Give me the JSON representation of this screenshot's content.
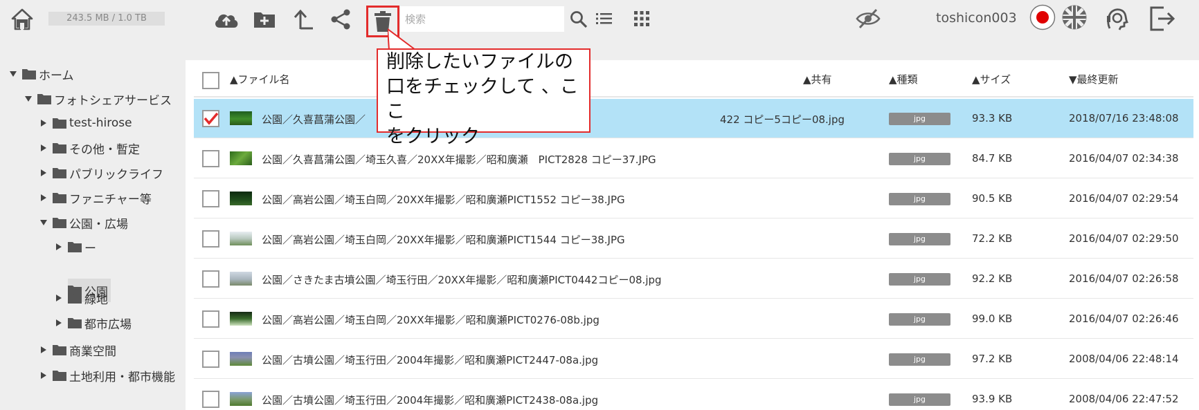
{
  "topbar": {
    "storage": "243.5 MB / 1.0 TB",
    "search_placeholder": "検索",
    "username": "toshicon003",
    "icons": [
      "home-icon",
      "cloud-upload-icon",
      "new-folder-icon",
      "upload-icon",
      "share-icon",
      "trash-icon",
      "search-icon",
      "list-view-icon",
      "grid-view-icon",
      "hide-icon",
      "japanese-flag-icon",
      "uk-flag-icon",
      "support-icon",
      "logout-icon"
    ]
  },
  "sidebar": {
    "items": [
      {
        "label": "ホーム",
        "expanded": true
      },
      {
        "label": "フォトシェアサービス",
        "expanded": true
      },
      {
        "label": "test-hirose",
        "expanded": false
      },
      {
        "label": "その他・暫定",
        "expanded": false
      },
      {
        "label": "パブリックライフ",
        "expanded": false
      },
      {
        "label": "ファニチャー等",
        "expanded": false
      },
      {
        "label": "公園・広場",
        "expanded": true
      },
      {
        "label": "ー",
        "expanded": false
      },
      {
        "label": "公園",
        "selected": true
      },
      {
        "label": "緑地",
        "expanded": false
      },
      {
        "label": "都市広場",
        "expanded": false
      },
      {
        "label": "商業空間",
        "expanded": false
      },
      {
        "label": "土地利用・都市機能",
        "expanded": false
      }
    ]
  },
  "table": {
    "headers": {
      "name": "▲ファイル名",
      "shared": "▲共有",
      "type": "▲種類",
      "size": "▲サイズ",
      "modified": "▼最終更新"
    },
    "rows": [
      {
        "name_start": "公園／久喜菖蒲公園／",
        "name_end": "422 コピー5コピー08.jpg",
        "type": "jpg",
        "size": "93.3 KB",
        "modified": "2018/07/16 23:48:08",
        "checked": true
      },
      {
        "name": "公園／久喜菖蒲公園／埼玉久喜／20XX年撮影／昭和廣瀬　PICT2828 コピー37.JPG",
        "type": "jpg",
        "size": "84.7 KB",
        "modified": "2016/04/07 02:34:38"
      },
      {
        "name": "公園／高岩公園／埼玉白岡／20XX年撮影／昭和廣瀬PICT1552 コピー38.JPG",
        "type": "jpg",
        "size": "90.5 KB",
        "modified": "2016/04/07 02:29:54"
      },
      {
        "name": "公園／高岩公園／埼玉白岡／20XX年撮影／昭和廣瀬PICT1544 コピー38.JPG",
        "type": "jpg",
        "size": "72.2 KB",
        "modified": "2016/04/07 02:29:50"
      },
      {
        "name": "公園／さきたま古墳公園／埼玉行田／20XX年撮影／昭和廣瀬PICT0442コピー08.jpg",
        "type": "jpg",
        "size": "92.2 KB",
        "modified": "2016/04/07 02:26:58"
      },
      {
        "name": "公園／高岩公園／埼玉白岡／20XX年撮影／昭和廣瀬PICT0276-08b.jpg",
        "type": "jpg",
        "size": "99.0 KB",
        "modified": "2016/04/07 02:26:46"
      },
      {
        "name": "公園／古墳公園／埼玉行田／2004年撮影／昭和廣瀬PICT2447-08a.jpg",
        "type": "jpg",
        "size": "97.2 KB",
        "modified": "2008/04/06 22:48:14"
      },
      {
        "name": "公園／古墳公園／埼玉行田／2004年撮影／昭和廣瀬PICT2438-08a.jpg",
        "type": "jpg",
        "size": "93.9 KB",
        "modified": "2008/04/06 22:47:52"
      }
    ]
  },
  "callout": {
    "line1": "削除したいファイルの",
    "line2": "口をチェックして 、ここ",
    "line3": "をクリック"
  },
  "colors": {
    "accent_red": "#e32b2b",
    "selected_row": "#b3e2f7",
    "icon_gray": "#555555"
  }
}
